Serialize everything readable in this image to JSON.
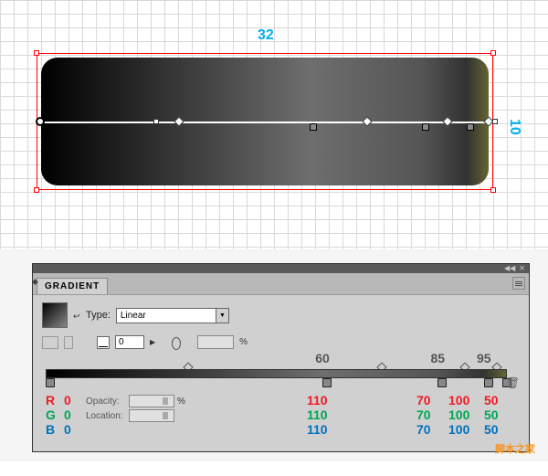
{
  "canvas": {
    "width_label": "32",
    "height_label": "10"
  },
  "panel": {
    "tab": "GRADIENT",
    "type_label": "Type:",
    "type_value": "Linear",
    "angle_value": "0",
    "ratio_pct_unit": "%",
    "opacity_label": "Opacity:",
    "opacity_unit": "%",
    "location_label": "Location:"
  },
  "stops": {
    "positions": [
      "60",
      "85",
      "95"
    ],
    "labels": {
      "r": "R",
      "g": "G",
      "b": "B"
    },
    "values": [
      {
        "r": "0",
        "g": "0",
        "b": "0"
      },
      {
        "r": "110",
        "g": "110",
        "b": "110"
      },
      {
        "r": "70",
        "g": "70",
        "b": "70"
      },
      {
        "r": "100",
        "g": "100",
        "b": "100"
      },
      {
        "r": "50",
        "g": "50",
        "b": "50"
      }
    ]
  },
  "watermark": "脚本之家"
}
